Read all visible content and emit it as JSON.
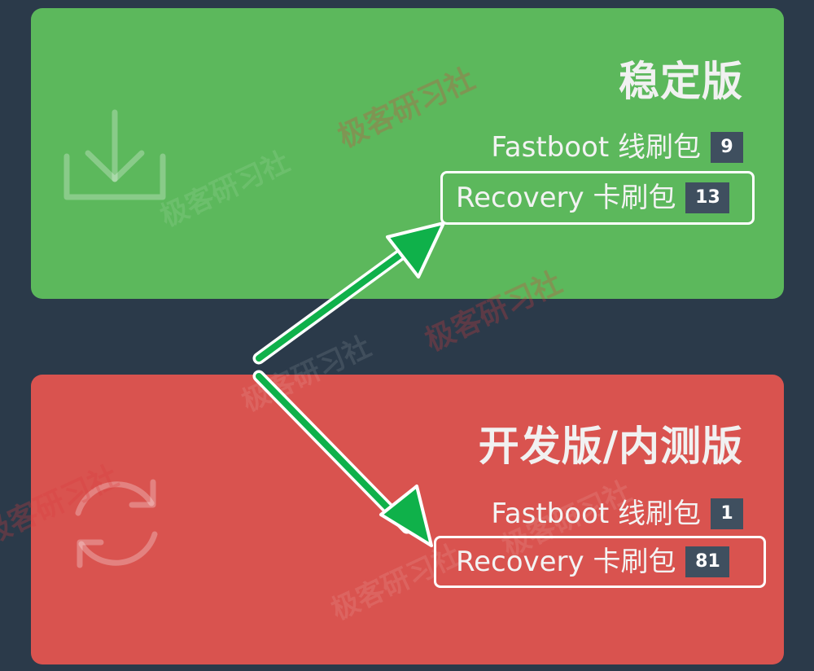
{
  "colors": {
    "page_background": "#2b3a4a",
    "stable_card": "#5cb85c",
    "dev_card": "#d9534f",
    "badge": "#3f4f5f",
    "arrow": "#0fb14a",
    "highlight_box": "#ffffff"
  },
  "stable": {
    "title": "稳定版",
    "icon": "download-icon",
    "fastboot_label": "Fastboot 线刷包",
    "fastboot_count": "9",
    "recovery_label": "Recovery 卡刷包",
    "recovery_count": "13"
  },
  "dev": {
    "title": "开发版/内测版",
    "icon": "refresh-icon",
    "fastboot_label": "Fastboot 线刷包",
    "fastboot_count": "1",
    "recovery_label": "Recovery 卡刷包",
    "recovery_count": "81"
  },
  "watermark": {
    "text": "极客研习社"
  }
}
